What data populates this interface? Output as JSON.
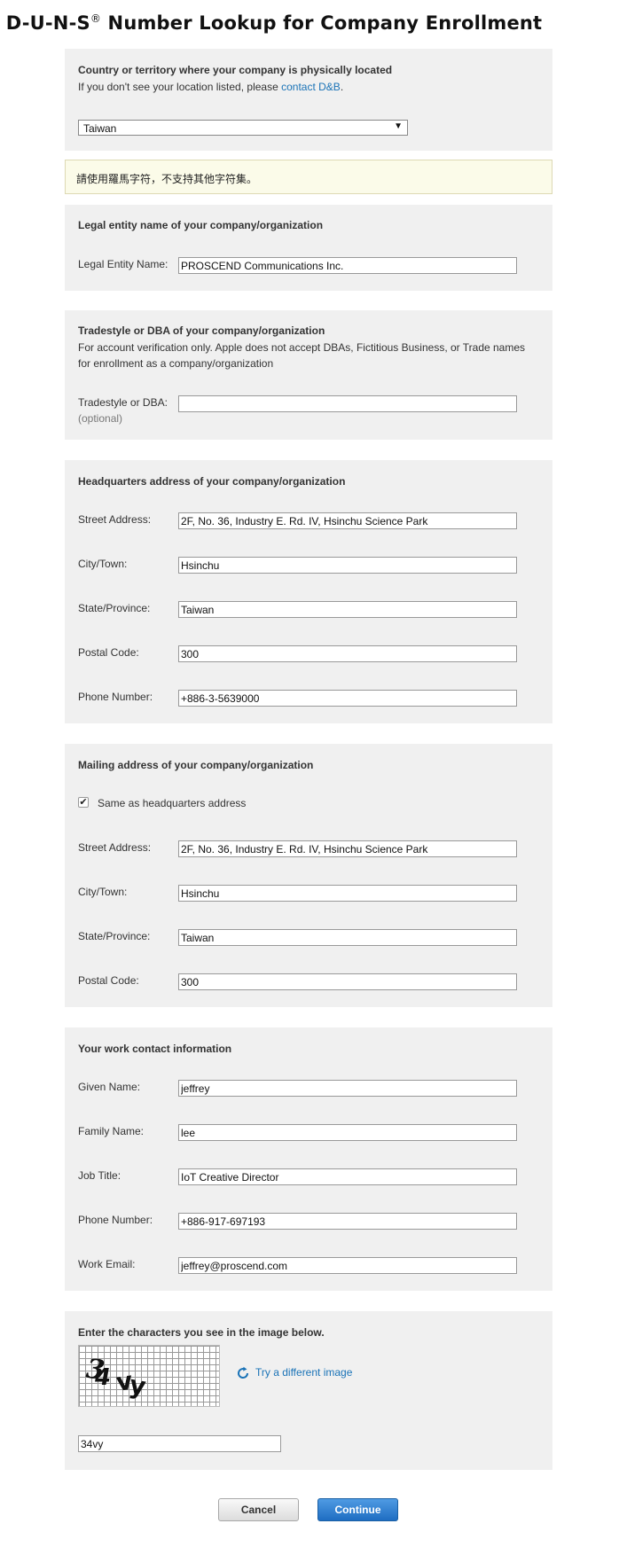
{
  "page": {
    "title": "D-U-N-S",
    "title_reg": "®",
    "title_rest": " Number Lookup for Company Enrollment"
  },
  "country": {
    "heading": "Country or territory where your company is physically located",
    "help_prefix": "If you don't see your location listed, please ",
    "help_link": "contact D&B",
    "help_suffix": ".",
    "selected": "Taiwan"
  },
  "notice": {
    "text": "請使用羅馬字符，不支持其他字符集。"
  },
  "legal": {
    "heading": "Legal entity name of your company/organization",
    "label": "Legal Entity Name:",
    "value": "PROSCEND Communications Inc."
  },
  "tradestyle": {
    "heading": "Tradestyle or DBA of your company/organization",
    "desc": "For account verification only. Apple does not accept DBAs, Fictitious Business, or Trade names for enrollment as a company/organization",
    "label": "Tradestyle or DBA:",
    "optional": "(optional)",
    "value": ""
  },
  "hq": {
    "heading": "Headquarters address of your company/organization",
    "street_label": "Street Address:",
    "street": "2F, No. 36, Industry E. Rd. IV, Hsinchu Science Park",
    "city_label": "City/Town:",
    "city": "Hsinchu",
    "state_label": "State/Province:",
    "state": "Taiwan",
    "postal_label": "Postal Code:",
    "postal": "300",
    "phone_label": "Phone Number:",
    "phone": "+886-3-5639000"
  },
  "mailing": {
    "heading": "Mailing address of your company/organization",
    "same_label": "Same as headquarters address",
    "same_checked": true,
    "street_label": "Street Address:",
    "street": "2F, No. 36, Industry E. Rd. IV, Hsinchu Science Park",
    "city_label": "City/Town:",
    "city": "Hsinchu",
    "state_label": "State/Province:",
    "state": "Taiwan",
    "postal_label": "Postal Code:",
    "postal": "300"
  },
  "contact": {
    "heading": "Your work contact information",
    "given_label": "Given Name:",
    "given": "jeffrey",
    "family_label": "Family Name:",
    "family": "lee",
    "job_label": "Job Title:",
    "job": "IoT Creative Director",
    "phone_label": "Phone Number:",
    "phone": "+886-917-697193",
    "email_label": "Work Email:",
    "email": "jeffrey@proscend.com"
  },
  "captcha": {
    "heading": "Enter the characters you see in the image below.",
    "image_text": "34vy",
    "refresh_label": "Try a different image",
    "value": "34vy"
  },
  "buttons": {
    "cancel": "Cancel",
    "continue": "Continue"
  },
  "colors": {
    "link": "#1a73b7",
    "panel": "#f0f0f0",
    "primary": "#1f6dc2",
    "notice_bg": "#fbfbe9"
  }
}
